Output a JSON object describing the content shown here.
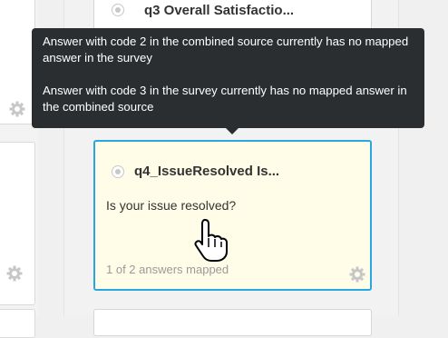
{
  "left_column": {
    "glyph": "/",
    "gear_icons": [
      "gear-icon",
      "gear-icon"
    ]
  },
  "top_card": {
    "title": "q3 Overall Satisfactio..."
  },
  "tooltip": {
    "line1": "Answer with code 2 in the combined source currently has no mapped answer in the survey",
    "line2": "Answer with code 3 in the survey currently has no mapped answer in the combined source"
  },
  "selected_card": {
    "title": "q4_IssueResolved Is...",
    "question": "Is your issue resolved?",
    "status": "1 of 2 answers mapped",
    "icon": "gear-icon"
  },
  "colors": {
    "selected_border": "#29a8e0",
    "selected_background": "#fffde7",
    "tooltip_background": "#2b2e31"
  },
  "cursor": "hand-pointer-cursor"
}
